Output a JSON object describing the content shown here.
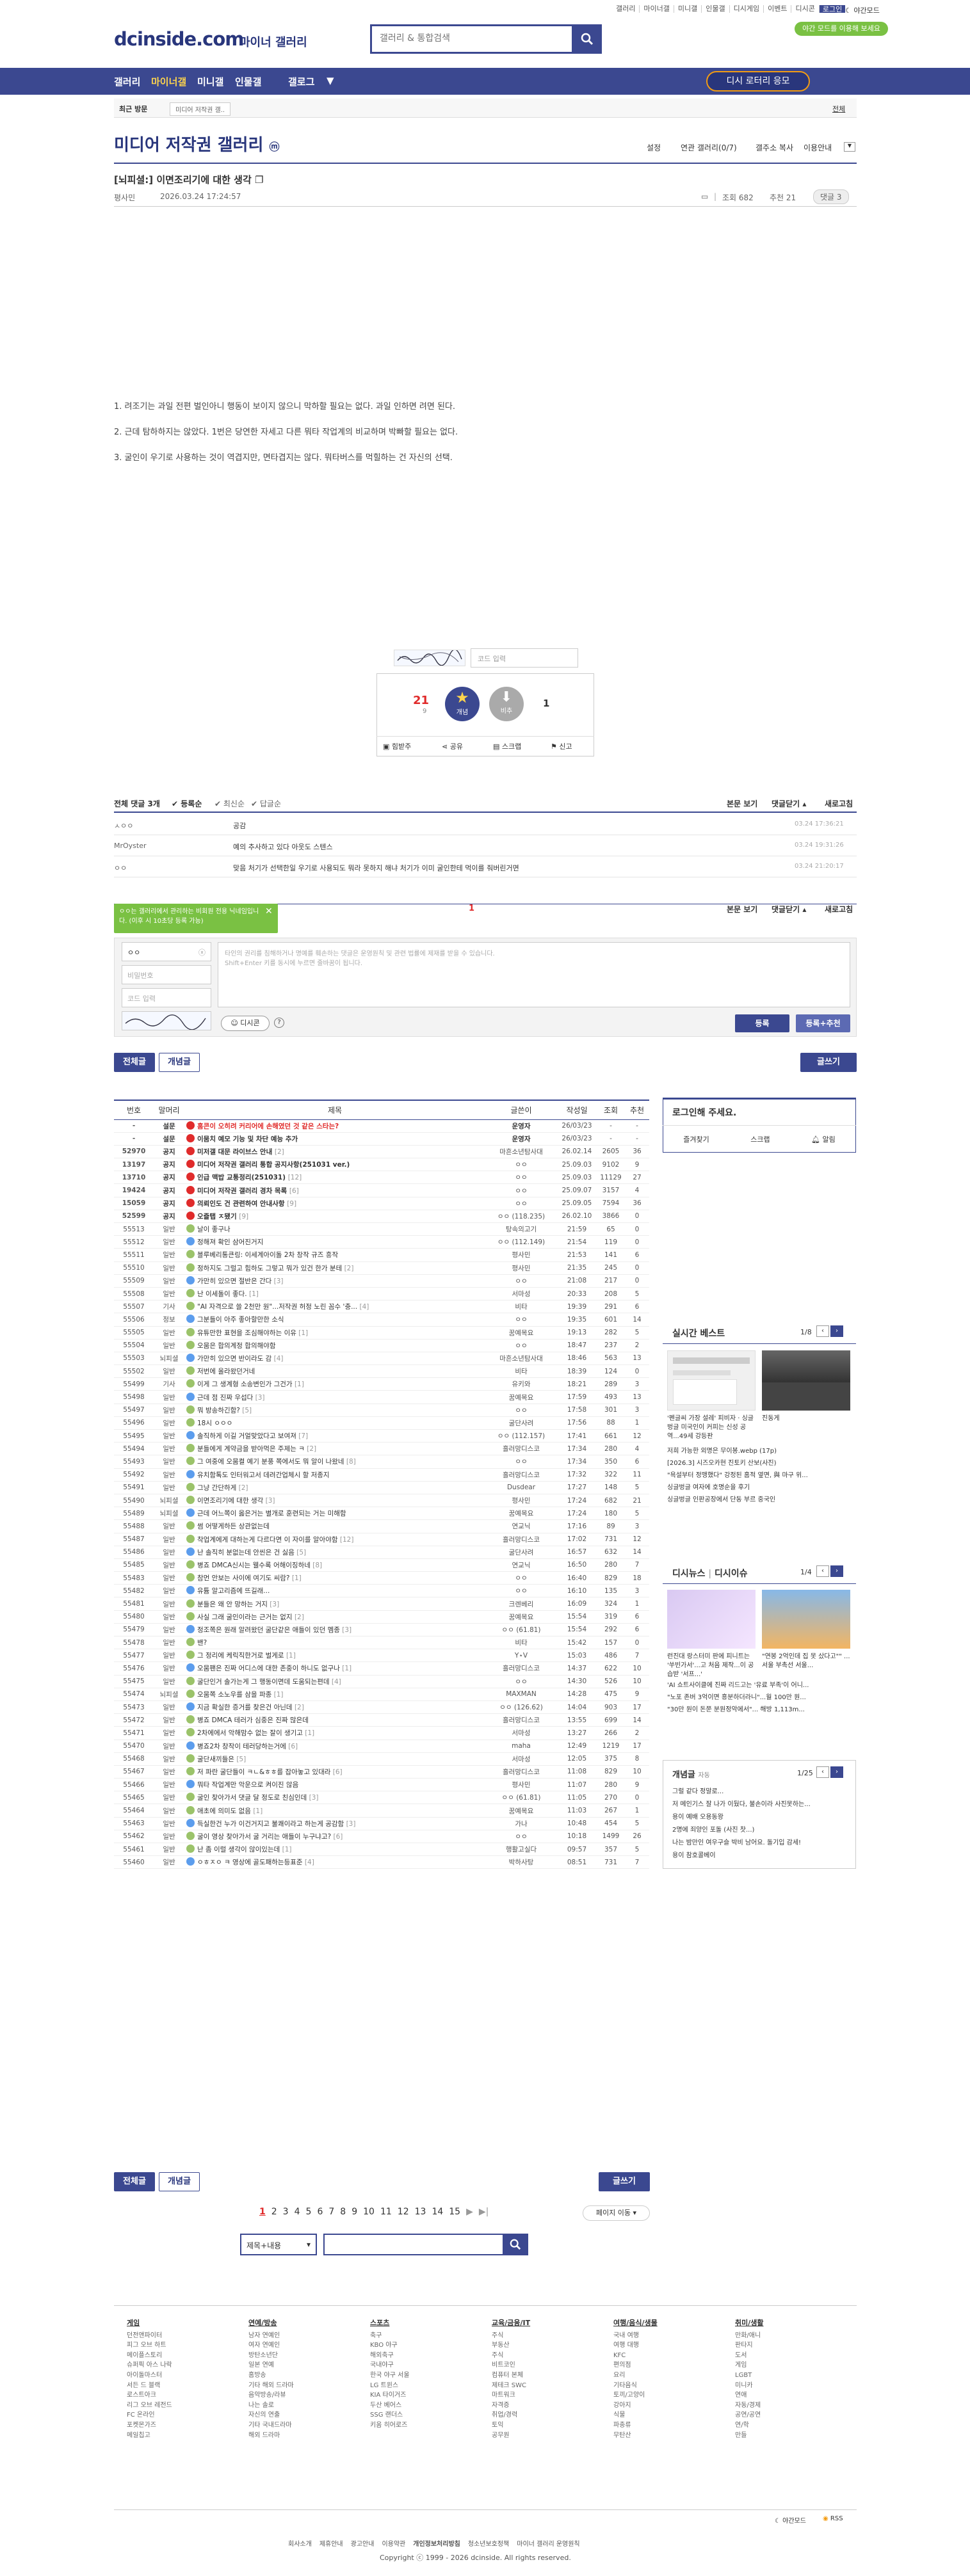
{
  "header": {
    "logo": "dcinside.com",
    "logo_sub": "마이너 갤러리",
    "search_placeholder": "갤러리 & 통합검색",
    "top_links": [
      "갤러리",
      "마이너갤",
      "미니갤",
      "인물갤",
      "디시게임",
      "이벤트",
      "디시콘",
      "로그인"
    ],
    "dark_mode": "야간모드",
    "green_banner": "야간 모드를 이용해 보세요"
  },
  "nav": {
    "items": [
      "갤러리",
      "마이너갤",
      "미니갤",
      "인물갤",
      "갤로그"
    ],
    "lottery": "디시 로터리 응모"
  },
  "breadcrumb": {
    "recent": "최근 방문",
    "current": "미디어 저작권 갤..",
    "all": "전체"
  },
  "gallery": {
    "title": "미디어 저작권 갤러리",
    "badge": "ⓜ",
    "tools": [
      "설정",
      "연관 갤러리(0/7)",
      "갤주소 복사",
      "이용안내"
    ]
  },
  "post": {
    "title": "[뇌피셜:] 이면조리기에 대한 생각",
    "author": "평사민",
    "date": "2026.03.24 17:24:57",
    "views_label": "조회 682",
    "likes_label": "추천 21",
    "comments_label": "댓글 3",
    "lines": [
      "1. 려조기는 과일 전편 벌인아니 행동이 보이지 않으니 막하할 필요는 없다. 과일 인하면 려면 된다.",
      "2. 근데 탐하하지는 않았다. 1번은 당연한 자세고 다른 뭐타 작업계의 비교하며 박빠할 필요는 없다.",
      "3. 굴인이 우기로 사용하는 것이 역겹지만, 면타겹지는 않다. 뭐타버스를 먹힐하는 건 자신의 선택."
    ],
    "captcha_placeholder": "코드 입력",
    "up_count": "21",
    "up_sub": "9",
    "up_label": "개념",
    "down_count": "1",
    "down_label": "비추",
    "actions": [
      "힘받주",
      "공유",
      "스크랩",
      "신고"
    ]
  },
  "comments": {
    "header_total": "전체 댓글 3개",
    "sort": [
      "등록순",
      "최신순",
      "답글순"
    ],
    "right_tools": [
      "본문 보기",
      "댓글닫기",
      "새로고침"
    ],
    "rows": [
      {
        "name": "ㅅㅇㅇ",
        "text": "공감",
        "date": "03.24 17:36:21"
      },
      {
        "name": "MrOyster",
        "text": "예의 추사하고 있다 아웃도 스텐스",
        "date": "03.24 19:31:26"
      },
      {
        "name": "ㅇㅇ",
        "text": "맞음 처기가 선택한일 우기로 사용되도 뭐라 못하지 해냐 처기가 이미 굴인한테 먹이를 줘버린거면",
        "date": "03.24 21:20:17"
      }
    ],
    "page": "1",
    "tooltip": "ㅇㅇ는 갤러리에서 관리하는 비회원 전용 닉네임입니다. (이후 시 10초당 등록 가능)",
    "write": {
      "nick": "ㅇㅇ",
      "password": "비밀번호",
      "code": "코드 입력",
      "placeholder": "타인의 권리를 침해하거나 명예를 훼손하는 댓글은 운영원칙 및 관련 법률에 제재를 받을 수 있습니다.\nShift+Enter 키를 동시에 누르면 줄바꿈이 됩니다.",
      "dccon": "디시콘",
      "submit": "등록",
      "submit_recommend": "등록+추천"
    }
  },
  "list": {
    "buttons": {
      "all": "전체글",
      "best": "개념글",
      "write": "글쓰기"
    },
    "columns": [
      "번호",
      "말머리",
      "제목",
      "글쓴이",
      "작성일",
      "조회",
      "추천"
    ],
    "rows": [
      {
        "no": "-",
        "head": "설문",
        "title": "홈콘이 오히려 커리어에 손해였던 것 같은 스타는?",
        "writer": "운영자",
        "date": "26/03/23",
        "views": "-",
        "rec": "-",
        "type": "hot"
      },
      {
        "no": "-",
        "head": "설문",
        "title": "이뭄치 예모 기능 및 차단 예능 추가",
        "writer": "운영자",
        "date": "26/03/23",
        "views": "-",
        "rec": "-",
        "type": "notice"
      },
      {
        "no": "52970",
        "head": "공지",
        "title": "미저갤 대문 라이브스 안내",
        "cnt": "[2]",
        "writer": "마흔소년탐사대",
        "date": "26.02.14",
        "views": "2605",
        "rec": "36",
        "type": "notice"
      },
      {
        "no": "13197",
        "head": "공지",
        "title": "미디어 저작권 갤러리 통합 공지사항(251031 ver.)",
        "writer": "ㅇㅇ",
        "date": "25.09.03",
        "views": "9102",
        "rec": "9",
        "type": "notice"
      },
      {
        "no": "13710",
        "head": "공지",
        "title": "인급 맥밥 교통정리(251031)",
        "cnt": "[12]",
        "writer": "ㅇㅇ",
        "date": "25.09.03",
        "views": "11129",
        "rec": "27",
        "type": "notice"
      },
      {
        "no": "19424",
        "head": "공지",
        "title": "미디어 저작권 갤러리 경차 목록",
        "cnt": "[6]",
        "writer": "ㅇㅇ",
        "date": "25.09.07",
        "views": "3157",
        "rec": "4",
        "type": "notice"
      },
      {
        "no": "15059",
        "head": "공지",
        "title": "의뢰인도 건 관련하여 안내사항",
        "cnt": "[9]",
        "writer": "ㅇㅇ",
        "date": "25.09.05",
        "views": "7594",
        "rec": "36",
        "type": "notice"
      },
      {
        "no": "52599",
        "head": "공지",
        "title": "오즐탭 ㅈ됐기",
        "cnt": "[9]",
        "writer": "ㅇㅇ (118.235)",
        "date": "26.02.10",
        "views": "3866",
        "rec": "0",
        "type": "notice"
      },
      {
        "no": "55513",
        "head": "일반",
        "title": "날이 좋구나",
        "writer": "탕속의고기",
        "date": "21:59",
        "views": "65",
        "rec": "0"
      },
      {
        "no": "55512",
        "head": "일반",
        "title": "정해져 확인 삼어진거지",
        "writer": "ㅇㅇ (112.149)",
        "date": "21:54",
        "views": "119",
        "rec": "0"
      },
      {
        "no": "55511",
        "head": "일반",
        "title": "블루베리통큰링: 이세계아이돌 2차 창작 규즈 흥작",
        "writer": "평사민",
        "date": "21:53",
        "views": "141",
        "rec": "6"
      },
      {
        "no": "55510",
        "head": "일반",
        "title": "정하지도 그럴고 힘하도 그렇고 뭐가 있건 한가 분테",
        "cnt": "[2]",
        "writer": "평사민",
        "date": "21:35",
        "views": "245",
        "rec": "0"
      },
      {
        "no": "55509",
        "head": "일반",
        "title": "가만히 있으면 절반은 간다",
        "cnt": "[3]",
        "writer": "ㅇㅇ",
        "date": "21:08",
        "views": "217",
        "rec": "0"
      },
      {
        "no": "55508",
        "head": "일반",
        "title": "난 이세돌이 좋다.",
        "cnt": "[1]",
        "writer": "서마성",
        "date": "20:33",
        "views": "208",
        "rec": "5"
      },
      {
        "no": "55507",
        "head": "기사",
        "title": "\"AI 자격으로 쓸 2천만 원\"...저작권 허정 노린 꼼수 '충...",
        "cnt": "[4]",
        "writer": "비타",
        "date": "19:39",
        "views": "291",
        "rec": "6"
      },
      {
        "no": "55506",
        "head": "정보",
        "title": "그분들이 아주 좋아할만한 소식",
        "writer": "ㅇㅇ",
        "date": "19:35",
        "views": "601",
        "rec": "14"
      },
      {
        "no": "55505",
        "head": "일반",
        "title": "유튜만한 표현을 조심해야하는 이유",
        "cnt": "[1]",
        "writer": "꿈예목요",
        "date": "19:13",
        "views": "282",
        "rec": "5"
      },
      {
        "no": "55504",
        "head": "일반",
        "title": "오뭄은 합의계정 합의해야함",
        "writer": "ㅇㅇ",
        "date": "18:47",
        "views": "237",
        "rec": "2"
      },
      {
        "no": "55503",
        "head": "뇌피셜",
        "title": "가만히 있으면 반이라도 감",
        "cnt": "[4]",
        "writer": "마흔소년탐사대",
        "date": "18:46",
        "views": "563",
        "rec": "13"
      },
      {
        "no": "55502",
        "head": "일반",
        "title": "저번에 올라왔던거네",
        "writer": "비타",
        "date": "18:39",
        "views": "124",
        "rec": "0"
      },
      {
        "no": "55499",
        "head": "기사",
        "title": "이게 그 생계형 소송변인가 그건가",
        "cnt": "[1]",
        "writer": "유키와",
        "date": "18:21",
        "views": "289",
        "rec": "3"
      },
      {
        "no": "55498",
        "head": "일반",
        "title": "근데 점 진짜 우섭다",
        "cnt": "[3]",
        "writer": "꿈예목요",
        "date": "17:59",
        "views": "493",
        "rec": "13"
      },
      {
        "no": "55497",
        "head": "일반",
        "title": "뭐 방송하긴함?",
        "cnt": "[5]",
        "writer": "ㅇㅇ",
        "date": "17:58",
        "views": "301",
        "rec": "3"
      },
      {
        "no": "55496",
        "head": "일반",
        "title": "18시 ㅇㅇㅇ",
        "writer": "굴단사려",
        "date": "17:56",
        "views": "88",
        "rec": "1"
      },
      {
        "no": "55495",
        "head": "일반",
        "title": "솔직하게 이길 거얼맞았다고 보여져",
        "cnt": "[7]",
        "writer": "ㅇㅇ (112.157)",
        "date": "17:41",
        "views": "661",
        "rec": "12"
      },
      {
        "no": "55494",
        "head": "일반",
        "title": "분들에게 계약금을 받아먹은 주제는 ㅋ",
        "cnt": "[2]",
        "writer": "흘러망디스코",
        "date": "17:34",
        "views": "280",
        "rec": "4"
      },
      {
        "no": "55493",
        "head": "일반",
        "title": "그 여중에 오뭄켤 예기 분풍 쪽에서도 뭐 알이 나왔네",
        "cnt": "[8]",
        "writer": "ㅇㅇ",
        "date": "17:34",
        "views": "350",
        "rec": "6"
      },
      {
        "no": "55492",
        "head": "일반",
        "title": "유치함톡도 인터워고서 데려간업체시 할 저종지",
        "writer": "흘러망디스코",
        "date": "17:32",
        "views": "322",
        "rec": "11"
      },
      {
        "no": "55491",
        "head": "일반",
        "title": "그냥 간단하게",
        "cnt": "[2]",
        "writer": "Dusdear",
        "date": "17:27",
        "views": "148",
        "rec": "5"
      },
      {
        "no": "55490",
        "head": "뇌피셜",
        "title": "이면조리기에 대한 생각",
        "cnt": "[3]",
        "writer": "평사민",
        "date": "17:24",
        "views": "682",
        "rec": "21"
      },
      {
        "no": "55489",
        "head": "뇌피셜",
        "title": "근데 어느쪽이 옳은거는 별개로 훈련되는 거는 미해함",
        "writer": "꿈예목요",
        "date": "17:24",
        "views": "180",
        "rec": "5"
      },
      {
        "no": "55488",
        "head": "일반",
        "title": "썸 어떻게하든 상관없는데",
        "writer": "연교닉",
        "date": "17:16",
        "views": "89",
        "rec": "3"
      },
      {
        "no": "55487",
        "head": "일반",
        "title": "착업계에게 대하는게 다르다면 이 자이를 알아야함",
        "cnt": "[12]",
        "writer": "흘러망디스코",
        "date": "17:02",
        "views": "731",
        "rec": "12"
      },
      {
        "no": "55486",
        "head": "일반",
        "title": "난 솔직히 분없는데 안씬은 건 싫음",
        "cnt": "[5]",
        "writer": "굴단사려",
        "date": "16:57",
        "views": "632",
        "rec": "14"
      },
      {
        "no": "55485",
        "head": "일반",
        "title": "병죠 DMCA신시는 웰수록 어해이징하네",
        "cnt": "[8]",
        "writer": "연교닉",
        "date": "16:50",
        "views": "280",
        "rec": "7"
      },
      {
        "no": "55483",
        "head": "일반",
        "title": "참먼 안보는 사이에 여기도 씨람?",
        "cnt": "[1]",
        "writer": "ㅇㅇ",
        "date": "16:40",
        "views": "829",
        "rec": "18"
      },
      {
        "no": "55482",
        "head": "일반",
        "title": "유튬 알고리즘에 뜨길래...",
        "writer": "ㅇㅇ",
        "date": "16:10",
        "views": "135",
        "rec": "3"
      },
      {
        "no": "55481",
        "head": "일반",
        "title": "분들은 왜 안 망하는 거지",
        "cnt": "[3]",
        "writer": "크렌베리",
        "date": "16:09",
        "views": "324",
        "rec": "1"
      },
      {
        "no": "55480",
        "head": "일반",
        "title": "사실 그래 굴인이라는 근거는 없지",
        "cnt": "[2]",
        "writer": "꿈예목요",
        "date": "15:54",
        "views": "319",
        "rec": "6"
      },
      {
        "no": "55479",
        "head": "일반",
        "title": "정조쪽은 원래 알려왔던 굴단같은 애들이 있던 멤종",
        "cnt": "[3]",
        "writer": "ㅇㅇ (61.81)",
        "date": "15:54",
        "views": "292",
        "rec": "6"
      },
      {
        "no": "55478",
        "head": "일반",
        "title": "밴?",
        "writer": "비타",
        "date": "15:42",
        "views": "157",
        "rec": "0"
      },
      {
        "no": "55477",
        "head": "일반",
        "title": "그 정리에 케릭직한거로 벌게로",
        "cnt": "[1]",
        "writer": "Y⋆V",
        "date": "15:03",
        "views": "486",
        "rec": "7"
      },
      {
        "no": "55476",
        "head": "일반",
        "title": "오뭄팬은 진짜 어디스에 대한 존중이 하니도 없구나",
        "cnt": "[1]",
        "writer": "흘러망디스코",
        "date": "14:37",
        "views": "622",
        "rec": "10"
      },
      {
        "no": "55475",
        "head": "일반",
        "title": "굴단인거 솔가는게 그 행동이면데 도움되는편데",
        "cnt": "[4]",
        "writer": "ㅇㅇ",
        "date": "14:30",
        "views": "526",
        "rec": "10"
      },
      {
        "no": "55474",
        "head": "뇌피셜",
        "title": "오뭄쪽 소노우를 삼을 파종",
        "cnt": "[1]",
        "writer": "MAXMAN",
        "date": "14:28",
        "views": "475",
        "rec": "9"
      },
      {
        "no": "55473",
        "head": "일반",
        "title": "지금 확실한 증거를 찾은건 아닌데",
        "cnt": "[2]",
        "writer": "ㅇㅇ (126.62)",
        "date": "14:04",
        "views": "903",
        "rec": "17"
      },
      {
        "no": "55472",
        "head": "일반",
        "title": "병죠 DMCA 테러가 심중은 진짜 많은데",
        "writer": "흘러망디스코",
        "date": "13:55",
        "views": "699",
        "rec": "14"
      },
      {
        "no": "55471",
        "head": "일반",
        "title": "2차에에서 악해맘수 없는 잘이 생기고",
        "cnt": "[1]",
        "writer": "서마성",
        "date": "13:27",
        "views": "266",
        "rec": "2"
      },
      {
        "no": "55470",
        "head": "일반",
        "title": "병죠2차 창작이 테러당하는거에",
        "cnt": "[6]",
        "writer": "maha",
        "date": "12:49",
        "views": "1219",
        "rec": "17"
      },
      {
        "no": "55468",
        "head": "일반",
        "title": "굴단새끼들은",
        "cnt": "[5]",
        "writer": "서마성",
        "date": "12:05",
        "views": "375",
        "rec": "8"
      },
      {
        "no": "55467",
        "head": "일반",
        "title": "저 파란 굴단들이 ㅋㄴ&ㅎㅎ를 잡아놓고 있대라",
        "cnt": "[6]",
        "writer": "흘러망디스코",
        "date": "11:08",
        "views": "829",
        "rec": "10"
      },
      {
        "no": "55466",
        "head": "일반",
        "title": "뭐타 작업계만 악운으로 켜이진 않음",
        "writer": "평사민",
        "date": "11:07",
        "views": "280",
        "rec": "9"
      },
      {
        "no": "55465",
        "head": "일반",
        "title": "굴인 찾아가서 댓글 달 정도로 친심인데",
        "cnt": "[3]",
        "writer": "ㅇㅇ (61.81)",
        "date": "11:05",
        "views": "270",
        "rec": "0"
      },
      {
        "no": "55464",
        "head": "일반",
        "title": "애초에 의미도 없음",
        "cnt": "[1]",
        "writer": "꿈예목요",
        "date": "11:03",
        "views": "267",
        "rec": "1"
      },
      {
        "no": "55463",
        "head": "일반",
        "title": "득실한건 누가 이건거지고 불쾌이라고 하는게 공감함",
        "cnt": "[3]",
        "writer": "가나",
        "date": "10:48",
        "views": "454",
        "rec": "5"
      },
      {
        "no": "55462",
        "head": "일반",
        "title": "굴이 영상 찾아가서 굴 거리는 애들이 누구냐고?",
        "cnt": "[6]",
        "writer": "ㅇㅇ",
        "date": "10:18",
        "views": "1499",
        "rec": "26"
      },
      {
        "no": "55461",
        "head": "일반",
        "title": "난 좀 이럴 생각이 않이있는데",
        "cnt": "[1]",
        "writer": "행활고실다",
        "date": "09:57",
        "views": "357",
        "rec": "5"
      },
      {
        "no": "55460",
        "head": "일반",
        "title": "ㅇㅎㅈㅇ ㅋ 영상에 골도패하는등표준",
        "cnt": "[4]",
        "writer": "박하사탕",
        "date": "08:51",
        "views": "731",
        "rec": "7"
      }
    ],
    "pages": [
      "1",
      "2",
      "3",
      "4",
      "5",
      "6",
      "7",
      "8",
      "9",
      "10",
      "11",
      "12",
      "13",
      "14",
      "15"
    ],
    "page_move": "페이지 이동",
    "search_select": "제목+내용"
  },
  "sidebar": {
    "login_prompt": "로그인해 주세요.",
    "login_links": [
      "즐겨찾기",
      "스크랩",
      "알림"
    ],
    "best_title": "실시간 베스트",
    "best_page": "1/8",
    "best_items": [
      {
        "img_caption": "",
        "text": "'펜글씨 가장 설레' 피비자 · 싱글벙글 미국인이 커피는 신성 공역...49세 강등판"
      },
      {
        "img_caption": "",
        "text": "진동게"
      }
    ],
    "best_list": [
      "저희 가능한 외명은 무이봉.webp (17p)",
      "[2026.3] 시즈오카현 진토키 산보(사진)",
      "\"욕설부터 정맹했다\" 강정된 홈적 옆면, 與 마구 위...",
      "싱글벙글 여자에 호명순을 후기",
      "싱글벙글 인판공장에서 단동 부르 중국인"
    ],
    "issue_title": "디시뉴스",
    "issue_sub": "디시이슈",
    "issue_page": "1/4",
    "issue_items": [
      {
        "text": "런진대 랑스터미 판에 피니트는 '쑤빈가서'...고 처음 제작...이 공습받 '서프...'"
      },
      {
        "text": "\"연봉 2억인데 집 못 샀다고\"\" ...서울 부촉선 서울..."
      }
    ],
    "issue_list": [
      "'AI 쇼트사이클에 진짜 리드고는 '유료 부족'이 어니...",
      "\"노포 존버 3억이면 흥분하더라니\"...월 100만 원...",
      "\"30만 원이 돈쭌 분원정악에서\"... 해방 1,113m..."
    ],
    "concept_title": "개념글",
    "concept_sub": "자동",
    "concept_page": "1/25",
    "concept_list": [
      "그럴 같다 정말로...",
      "저 메인기스 잘 나가 이뒀다, 불손이라 사진못하는...",
      "용이 예배 오용동왕",
      "2명에 죄양인 포돌 (사진 찻...)",
      "나는 밤만인 여우구슬 박비 남어요. 돌기입 감세!",
      "용이 참호콜베이"
    ]
  },
  "footer": {
    "columns": [
      {
        "title": "게임",
        "items": [
          "던전앤파이터",
          "피그 오브 하트",
          "메이플스토리",
          "슈퍼픽 아스 나락",
          "아이돌마스터",
          "서든 드 블랙",
          "로스트아크",
          "리그 오브 레전드",
          "FC 온라인",
          "포켓몬가즈",
          "메일칩고"
        ]
      },
      {
        "title": "연예/방송",
        "items": [
          "남자 연예인",
          "여자 연예인",
          "방탄소년단",
          "일본 연예",
          "홈방송",
          "기타 해외 드라마",
          "음악방송/라뷰",
          "나는 솔로",
          "자신의 연출",
          "기타 국내드라마",
          "해외 드라마"
        ]
      },
      {
        "title": "스포츠",
        "items": [
          "축구",
          "KBO 야구",
          "해외축구",
          "국내야구",
          "한국 야구 서울",
          "LG 트윈스",
          "KIA 타이거즈",
          "두산 베어스",
          "SSG 랜더스",
          "키움 히어로즈"
        ]
      },
      {
        "title": "교육/금융/IT",
        "items": [
          "주식",
          "부동산",
          "주식",
          "비트코인",
          "컴퓨터 본체",
          "제테크 SWC",
          "마트워크",
          "자격증",
          "취업/경력",
          "토익",
          "공무원"
        ]
      },
      {
        "title": "여행/음식/생물",
        "items": [
          "국내 여행",
          "여행 대행",
          "KFC",
          "편의점",
          "요리",
          "기타음식",
          "토끼/고양이",
          "강아지",
          "식물",
          "파충류",
          "무탄산"
        ]
      },
      {
        "title": "취미/생활",
        "items": [
          "만화/애니",
          "판타지",
          "도서",
          "게임",
          "LGBT",
          "미니카",
          "연애",
          "자동/경제",
          "공연/공연",
          "연/학",
          "만들"
        ]
      }
    ],
    "night_mode": "야간모드",
    "rss": "RSS",
    "links": [
      "회사소개",
      "제휴안내",
      "광고안내",
      "이용약관",
      "개인정보처리방침",
      "청소년보호정책",
      "마이너 갤러리 운영원칙"
    ],
    "copyright": "Copyright ⓒ 1999 - 2026 dcinside. All rights reserved."
  },
  "colors": {
    "navy": "#3b4890",
    "navy_dark": "#29367c",
    "green": "#7ac143",
    "red": "#e02b2b",
    "orange": "#f39c12"
  }
}
